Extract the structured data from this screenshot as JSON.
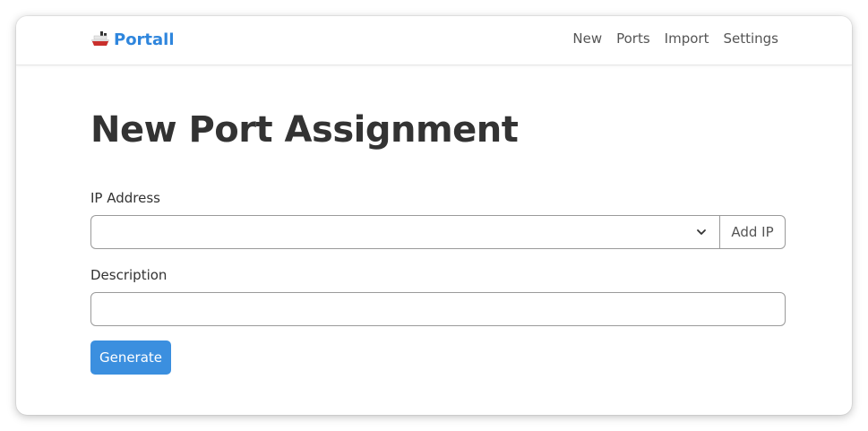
{
  "brand": {
    "name": "Portall",
    "icon": "ship-icon",
    "color": "#2f86dd"
  },
  "nav": {
    "items": [
      {
        "label": "New"
      },
      {
        "label": "Ports"
      },
      {
        "label": "Import"
      },
      {
        "label": "Settings"
      }
    ]
  },
  "page": {
    "title": "New Port Assignment"
  },
  "form": {
    "ip_label": "IP Address",
    "ip_value": "",
    "add_ip_label": "Add IP",
    "description_label": "Description",
    "description_value": "",
    "submit_label": "Generate",
    "submit_color": "#3b8fdf"
  }
}
